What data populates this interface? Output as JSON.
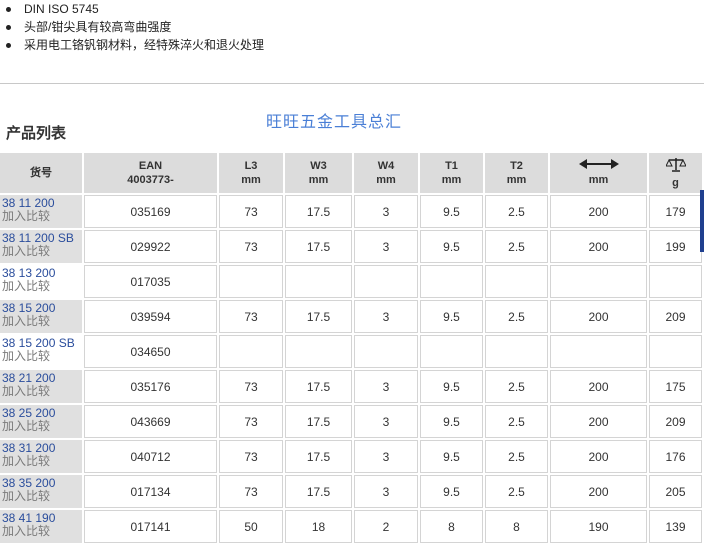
{
  "features": [
    "DIN ISO 5745",
    "头部/钳尖具有较高弯曲强度",
    "采用电工铬钒钢材料，经特殊淬火和退火处理"
  ],
  "watermark": "旺旺五金工具总汇",
  "section_title": "产品列表",
  "table": {
    "headers": {
      "article": "货号",
      "ean_1": "EAN",
      "ean_2": "4003773-",
      "l3_1": "L3",
      "l3_2": "mm",
      "w3_1": "W3",
      "w3_2": "mm",
      "w4_1": "W4",
      "w4_2": "mm",
      "t1_1": "T1",
      "t1_2": "mm",
      "t2_1": "T2",
      "t2_2": "mm",
      "length_unit": "mm",
      "weight_unit": "g"
    },
    "icons": {
      "length": "double-arrow-icon",
      "weight": "balance-scale-icon"
    },
    "compare_label": "加入比较",
    "rows": [
      {
        "art": "38 11 200",
        "ean": "035169",
        "l3": "73",
        "w3": "17.5",
        "w4": "3",
        "t1": "9.5",
        "t2": "2.5",
        "len": "200",
        "g": "179"
      },
      {
        "art": "38 11 200 SB",
        "ean": "029922",
        "l3": "73",
        "w3": "17.5",
        "w4": "3",
        "t1": "9.5",
        "t2": "2.5",
        "len": "200",
        "g": "199"
      },
      {
        "art": "38 13 200",
        "ean": "017035",
        "l3": "",
        "w3": "",
        "w4": "",
        "t1": "",
        "t2": "",
        "len": "",
        "g": ""
      },
      {
        "art": "38 15 200",
        "ean": "039594",
        "l3": "73",
        "w3": "17.5",
        "w4": "3",
        "t1": "9.5",
        "t2": "2.5",
        "len": "200",
        "g": "209"
      },
      {
        "art": "38 15 200 SB",
        "ean": "034650",
        "l3": "",
        "w3": "",
        "w4": "",
        "t1": "",
        "t2": "",
        "len": "",
        "g": ""
      },
      {
        "art": "38 21 200",
        "ean": "035176",
        "l3": "73",
        "w3": "17.5",
        "w4": "3",
        "t1": "9.5",
        "t2": "2.5",
        "len": "200",
        "g": "175"
      },
      {
        "art": "38 25 200",
        "ean": "043669",
        "l3": "73",
        "w3": "17.5",
        "w4": "3",
        "t1": "9.5",
        "t2": "2.5",
        "len": "200",
        "g": "209"
      },
      {
        "art": "38 31 200",
        "ean": "040712",
        "l3": "73",
        "w3": "17.5",
        "w4": "3",
        "t1": "9.5",
        "t2": "2.5",
        "len": "200",
        "g": "176"
      },
      {
        "art": "38 35 200",
        "ean": "017134",
        "l3": "73",
        "w3": "17.5",
        "w4": "3",
        "t1": "9.5",
        "t2": "2.5",
        "len": "200",
        "g": "205"
      },
      {
        "art": "38 41 190",
        "ean": "017141",
        "l3": "50",
        "w3": "18",
        "w4": "2",
        "t1": "8",
        "t2": "8",
        "len": "190",
        "g": "139"
      }
    ]
  }
}
